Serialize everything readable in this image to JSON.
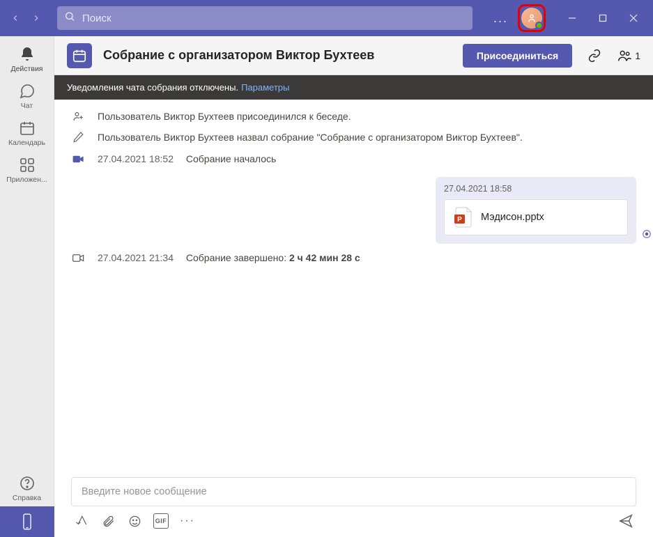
{
  "colors": {
    "accent": "#5558af",
    "highlight_border": "#e40000",
    "presence_available": "#6bb700"
  },
  "titlebar": {
    "search_placeholder": "Поиск",
    "more_label": "..."
  },
  "sidebar": {
    "items": [
      {
        "id": "activity",
        "label": "Действия"
      },
      {
        "id": "chat",
        "label": "Чат"
      },
      {
        "id": "calendar",
        "label": "Календарь"
      },
      {
        "id": "apps",
        "label": "Приложен..."
      }
    ],
    "help_label": "Справка"
  },
  "header": {
    "title": "Собрание с организатором Виктор Бухтеев",
    "join_label": "Присоединиться",
    "participant_count": "1"
  },
  "notification": {
    "text": "Уведомления чата собрания отключены.",
    "link": "Параметры"
  },
  "chat": {
    "events": [
      {
        "kind": "join",
        "text": "Пользователь Виктор Бухтеев присоединился к беседе."
      },
      {
        "kind": "rename",
        "text": "Пользователь Виктор Бухтеев назвал собрание \"Собрание с организатором Виктор Бухтеев\"."
      },
      {
        "kind": "start",
        "ts": "27.04.2021 18:52",
        "text": "Собрание началось"
      }
    ],
    "message": {
      "ts": "27.04.2021 18:58",
      "file_name": "Мэдисон.pptx",
      "file_type": "powerpoint"
    },
    "end_event": {
      "ts": "27.04.2021 21:34",
      "prefix": "Собрание завершено: ",
      "duration": "2 ч 42 мин 28 с"
    }
  },
  "compose": {
    "placeholder": "Введите новое сообщение",
    "gif_label": "GIF"
  }
}
